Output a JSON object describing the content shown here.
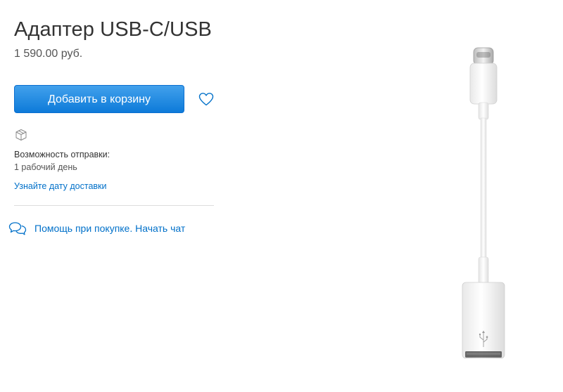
{
  "product": {
    "title": "Адаптер USB-C/USB",
    "price": "1 590.00 руб."
  },
  "actions": {
    "add_to_bag_label": "Добавить в корзину",
    "favorite_icon": "heart-icon"
  },
  "shipping": {
    "icon": "box-icon",
    "label": "Возможность отправки:",
    "value": "1 рабочий день",
    "delivery_link": "Узнайте дату доставки"
  },
  "help": {
    "icon": "chat-bubbles-icon",
    "text": "Помощь при покупке. Начать чат"
  },
  "colors": {
    "accent": "#0070c9",
    "button_top": "#42a1ec",
    "button_bottom": "#0d7ad9",
    "divider": "#dddddd"
  }
}
